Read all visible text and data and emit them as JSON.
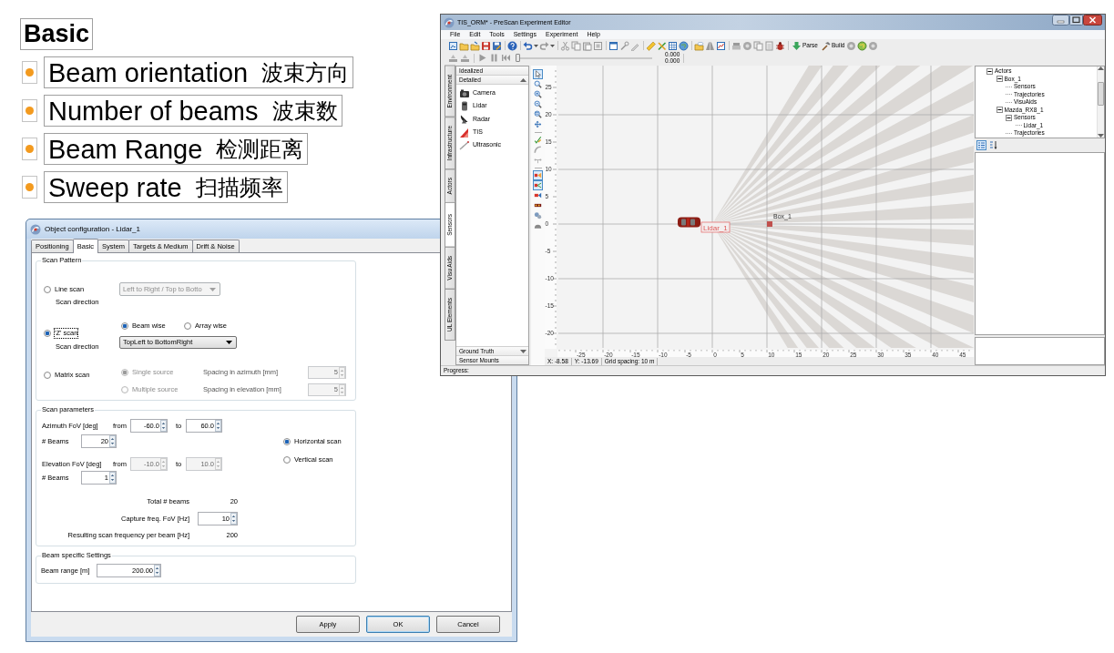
{
  "slide": {
    "heading": "Basic",
    "bullets": [
      {
        "text": "Beam orientation",
        "translation": "波束方向"
      },
      {
        "text": "Number of beams",
        "translation": "波束数"
      },
      {
        "text": "Beam Range",
        "translation": "检测距离"
      },
      {
        "text": "Sweep rate",
        "translation": "扫描频率"
      }
    ]
  },
  "editor": {
    "title": "TIS_ORM* - PreScan Experiment Editor",
    "menu": [
      "File",
      "Edit",
      "Tools",
      "Settings",
      "Experiment",
      "Help"
    ],
    "toolbar_buttons": [
      {
        "label": "Parse"
      },
      {
        "label": "Build"
      }
    ],
    "timeline": {
      "level": 0
    },
    "time_readings": [
      "0.000",
      "0.000"
    ],
    "side_tabs": [
      {
        "label": "Environment",
        "selected": false
      },
      {
        "label": "Infrastructure",
        "selected": false
      },
      {
        "label": "Actors",
        "selected": false
      },
      {
        "label": "Sensors",
        "selected": true
      },
      {
        "label": "Visu Aids",
        "selected": false
      },
      {
        "label": "UL Elements",
        "selected": false
      }
    ],
    "library": {
      "headers": [
        "Idealized",
        "Detailed"
      ],
      "items": [
        "Camera",
        "Lidar",
        "Radar",
        "TIS",
        "Ultrasonic"
      ],
      "footer": [
        "Ground Truth",
        "Sensor Mounts"
      ]
    },
    "tool_palette": [
      {
        "selected": true
      },
      {
        "selected": false
      },
      {
        "selected": false
      },
      {
        "selected": false
      },
      {
        "selected": false
      },
      {
        "selected": false
      },
      {
        "selected": false
      },
      {
        "selected": false
      },
      {
        "selected": false
      },
      {
        "selected": true
      },
      {
        "selected": true
      },
      {
        "selected": false
      },
      {
        "selected": false
      },
      {
        "selected": false
      },
      {
        "selected": false
      }
    ],
    "scene": {
      "y_ruler": [
        "25",
        "20",
        "15",
        "10",
        "5",
        "0",
        "-5",
        "-10",
        "-15",
        "-20"
      ],
      "x_ruler": [
        "-25",
        "-20",
        "-15",
        "-10",
        "-5",
        "0",
        "5",
        "10",
        "15",
        "20",
        "25",
        "30",
        "35",
        "40",
        "45"
      ],
      "sensor_label": "Lidar_1",
      "object_label": "Box_1"
    },
    "status": [
      "X: -8.58",
      "Y: -13.69",
      "Grid spacing: 10 m"
    ],
    "tree": [
      {
        "label": "Actors",
        "expanded": true,
        "children": [
          {
            "label": "Box_1",
            "expanded": true,
            "children": [
              {
                "label": "Sensors"
              },
              {
                "label": "Trajectories"
              },
              {
                "label": "VisuAids"
              }
            ]
          },
          {
            "label": "Mazda_RX8_1",
            "expanded": true,
            "children": [
              {
                "label": "Sensors",
                "expanded": true,
                "children": [
                  {
                    "label": "Lidar_1"
                  }
                ]
              },
              {
                "label": "Trajectories"
              }
            ]
          }
        ]
      }
    ],
    "progress_label": "Progress:"
  },
  "config_dialog": {
    "title": "Object configuration - Lidar_1",
    "tabs": [
      {
        "label": "Positioning",
        "selected": false
      },
      {
        "label": "Basic",
        "selected": true
      },
      {
        "label": "System",
        "selected": false
      },
      {
        "label": "Targets & Medium",
        "selected": false
      },
      {
        "label": "Drift & Noise",
        "selected": false
      }
    ],
    "scan_pattern": {
      "title": "Scan Pattern",
      "line_scan": {
        "label": "Line scan",
        "selected": false,
        "focused": false,
        "sublabel": "Scan direction",
        "direction": {
          "value": "Left to Right / Top to Botto",
          "disabled": true
        }
      },
      "z_scan": {
        "label": "'Z' scan",
        "selected": true,
        "focused": true,
        "sublabel": "Scan direction",
        "order": [
          {
            "label": "Beam wise",
            "selected": true
          },
          {
            "label": "Array wise",
            "selected": false
          }
        ],
        "direction": {
          "value": "TopLeft to BottomRight",
          "disabled": false
        }
      },
      "matrix_scan": {
        "label": "Matrix scan",
        "selected": false,
        "focused": false,
        "sources": [
          {
            "label": "Single source",
            "selected": true,
            "disabled": true
          },
          {
            "label": "Multiple source",
            "selected": false,
            "disabled": true
          }
        ],
        "spacings": [
          {
            "label": "Spacing in azimuth [mm]",
            "value": "5",
            "disabled": true
          },
          {
            "label": "Spacing in elevation [mm]",
            "value": "5",
            "disabled": true
          }
        ]
      }
    },
    "scan_parameters": {
      "title": "Scan parameters",
      "fov_rows": [
        {
          "label": "Azimuth FoV [deg]",
          "from_label": "from",
          "from": "-60.0",
          "to_label": "to",
          "to": "60.0",
          "disabled": false,
          "beams_label": "# Beams",
          "beams": "20"
        },
        {
          "label": "Elevation FoV [deg]",
          "from_label": "from",
          "from": "-10.0",
          "to_label": "to",
          "to": "10.0",
          "disabled": true,
          "beams_label": "# Beams",
          "beams": "1"
        }
      ],
      "scan_orientation": [
        {
          "label": "Horizontal scan",
          "selected": true
        },
        {
          "label": "Vertical scan",
          "selected": false
        }
      ],
      "total_beams": {
        "label": "Total # beams",
        "value": "20"
      },
      "capture_freq": {
        "label": "Capture freq. FoV [Hz]",
        "value": "10"
      },
      "resulting_freq": {
        "label": "Resulting scan frequency per beam [Hz]",
        "value": "200"
      }
    },
    "beam_settings": {
      "title": "Beam specific Settings",
      "range": {
        "label": "Beam range [m]",
        "value": "200.00"
      }
    },
    "buttons": [
      {
        "label": "Apply",
        "default": false
      },
      {
        "label": "OK",
        "default": true
      },
      {
        "label": "Cancel",
        "default": false
      }
    ]
  }
}
